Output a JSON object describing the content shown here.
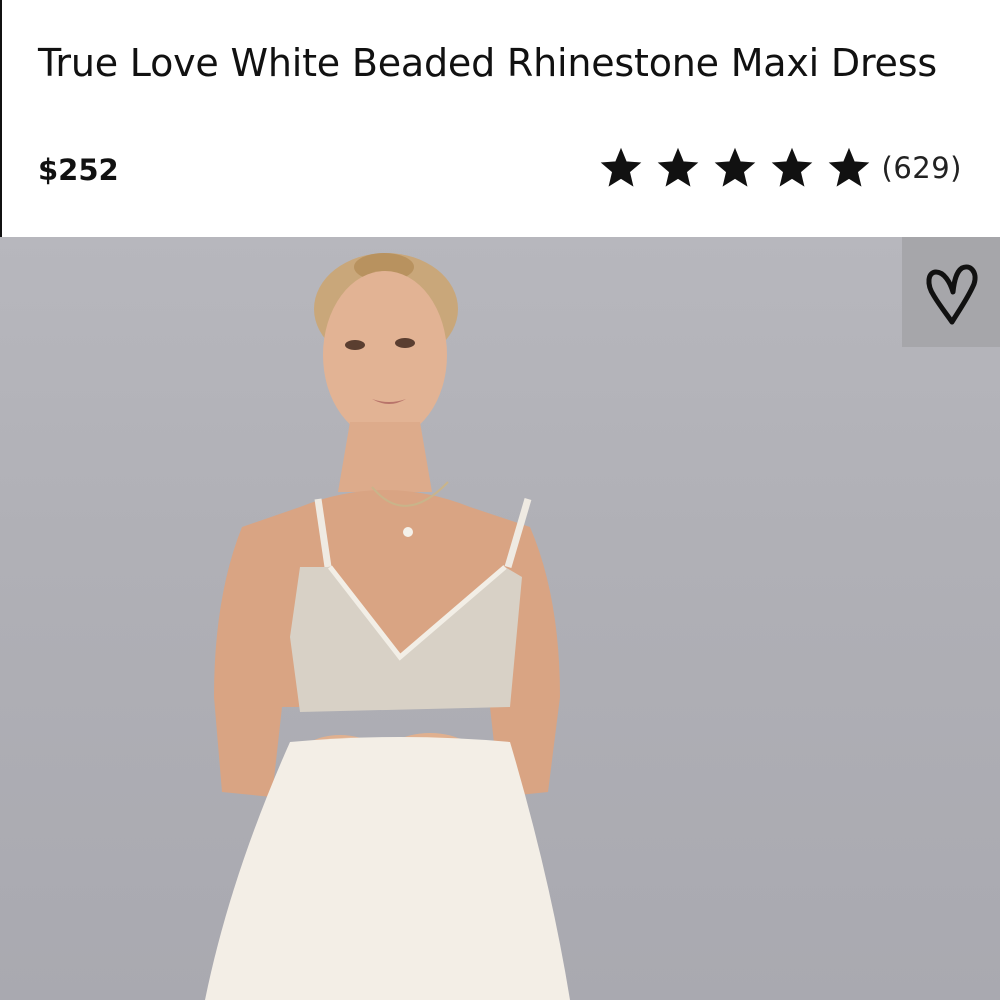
{
  "product": {
    "title": "True Love White Beaded Rhinestone Maxi Dress",
    "price": "$252",
    "rating": 5,
    "rating_max": 5,
    "review_count": "(629)"
  },
  "image": {
    "favorite_icon": "heart-icon"
  },
  "colors": {
    "text": "#111111",
    "photo_background": "#b0b0b6",
    "favorite_button_background": "#a6a6aa"
  }
}
